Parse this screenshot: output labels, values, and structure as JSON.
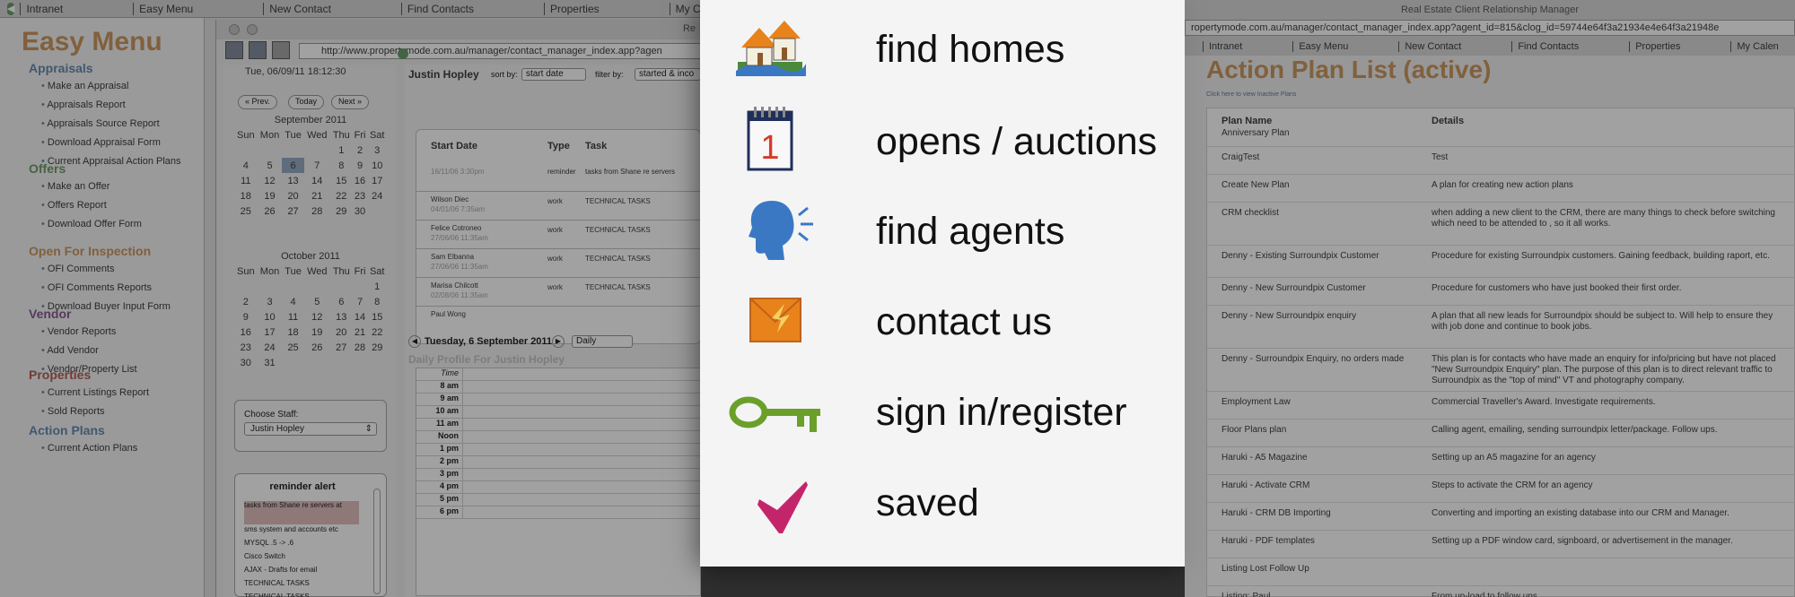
{
  "left_app": {
    "topnav": [
      "Intranet",
      "Easy Menu",
      "New Contact",
      "Find Contacts",
      "Properties",
      "My Calendar",
      "My"
    ],
    "brand": "Easy Menu",
    "sections": [
      {
        "title": "Appraisals",
        "color": "#3a7bc8",
        "items": [
          "Make an Appraisal",
          "Appraisals Report",
          "Appraisals Source Report",
          "Download Appraisal Form",
          "Current Appraisal Action Plans"
        ]
      },
      {
        "title": "Offers",
        "color": "#3a9a3a",
        "items": [
          "Make an Offer",
          "Offers Report",
          "Download Offer Form"
        ]
      },
      {
        "title": "Open For Inspection",
        "color": "#e8821a",
        "items": [
          "OFI Comments",
          "OFI Comments Reports",
          "Download Buyer Input Form"
        ]
      },
      {
        "title": "Vendor",
        "color": "#8a3aa8",
        "items": [
          "Vendor Reports",
          "Add Vendor",
          "Vendor/Property List"
        ]
      },
      {
        "title": "Properties",
        "color": "#d83a2a",
        "items": [
          "Current Listings Report",
          "Sold Reports"
        ]
      },
      {
        "title": "Action Plans",
        "color": "#3a7bc8",
        "items": [
          "Current Action Plans"
        ]
      }
    ],
    "browser": {
      "window_title": "Re",
      "url": "http://www.propertymode.com.au/manager/contact_manager_index.app?agen",
      "datetime": "Tue, 06/09/11 18:12:30",
      "nav": {
        "prev": "« Prev.",
        "today": "Today",
        "next": "Next »"
      },
      "calendars": [
        {
          "month": "September 2011",
          "headers": [
            "Sun",
            "Mon",
            "Tue",
            "Wed",
            "Thu",
            "Fri",
            "Sat"
          ],
          "weeks": [
            [
              "",
              "",
              "",
              "",
              "1",
              "2",
              "3"
            ],
            [
              "4",
              "5",
              "6",
              "7",
              "8",
              "9",
              "10"
            ],
            [
              "11",
              "12",
              "13",
              "14",
              "15",
              "16",
              "17"
            ],
            [
              "18",
              "19",
              "20",
              "21",
              "22",
              "23",
              "24"
            ],
            [
              "25",
              "26",
              "27",
              "28",
              "29",
              "30",
              ""
            ]
          ]
        },
        {
          "month": "October 2011",
          "headers": [
            "Sun",
            "Mon",
            "Tue",
            "Wed",
            "Thu",
            "Fri",
            "Sat"
          ],
          "weeks": [
            [
              "",
              "",
              "",
              "",
              "",
              "",
              "1"
            ],
            [
              "2",
              "3",
              "4",
              "5",
              "6",
              "7",
              "8"
            ],
            [
              "9",
              "10",
              "11",
              "12",
              "13",
              "14",
              "15"
            ],
            [
              "16",
              "17",
              "18",
              "19",
              "20",
              "21",
              "22"
            ],
            [
              "23",
              "24",
              "25",
              "26",
              "27",
              "28",
              "29"
            ],
            [
              "30",
              "31",
              "",
              "",
              "",
              "",
              ""
            ]
          ]
        }
      ],
      "choose_staff_label": "Choose Staff:",
      "staff_value": "Justin Hopley",
      "reminder_title": "reminder alert",
      "reminders": [
        "tasks from Shane re servers at",
        "sms system and accounts etc",
        "MYSQL .5 -> .6",
        "Cisco Switch",
        "AJAX - Drafts for email",
        "TECHNICAL TASKS",
        "TECHNICAL TASKS"
      ],
      "contact_name": "Justin Hopley",
      "sort_by_label": "sort by:",
      "sort_value": "start date",
      "filter_label": "filter by:",
      "filter_value": "started & inco",
      "table_headers": [
        "Start Date",
        "Type",
        "Task"
      ],
      "tasks": [
        {
          "name": "",
          "date": "16/11/06 3:30pm",
          "type": "reminder",
          "task": "tasks from Shane re servers"
        },
        {
          "name": "Wilson Diec",
          "date": "04/01/06 7:35am",
          "type": "work",
          "task": "TECHNICAL TASKS"
        },
        {
          "name": "Felice Cotroneo",
          "date": "27/06/06 11:35am",
          "type": "work",
          "task": "TECHNICAL TASKS"
        },
        {
          "name": "Sam Elbanna",
          "date": "27/06/06 11:35am",
          "type": "work",
          "task": "TECHNICAL TASKS"
        },
        {
          "name": "Marisa Chilcott",
          "date": "02/08/06 11:35am",
          "type": "work",
          "task": "TECHNICAL TASKS"
        },
        {
          "name": "Paul Wong",
          "date": "",
          "type": "",
          "task": ""
        }
      ],
      "day_date": "Tuesday, 6 September 2011",
      "view_value": "Daily",
      "daily_profile_title": "Daily Profile For Justin Hopley",
      "time_header": "Time",
      "times": [
        "8 am",
        "9 am",
        "10 am",
        "11 am",
        "Noon",
        "1 pm",
        "2 pm",
        "3 pm",
        "4 pm",
        "5 pm",
        "6 pm"
      ]
    }
  },
  "center_menu": [
    {
      "label": "find homes",
      "icon": "house-icon"
    },
    {
      "label": "opens / auctions",
      "icon": "calendar-icon"
    },
    {
      "label": "find agents",
      "icon": "speaking-head-icon"
    },
    {
      "label": "contact us",
      "icon": "envelope-icon"
    },
    {
      "label": "sign in/register",
      "icon": "key-icon"
    },
    {
      "label": "saved",
      "icon": "checkmark-icon"
    }
  ],
  "center_calendar_number": "1",
  "right_app": {
    "window_title": "Real Estate Client Relationship Manager",
    "url": "ropertymode.com.au/manager/contact_manager_index.app?agent_id=815&clog_id=59744e64f3a21934e4e64f3a21948e",
    "topnav": [
      "Intranet",
      "Easy Menu",
      "New Contact",
      "Find Contacts",
      "Properties",
      "My Calen"
    ],
    "title": "Action Plan List (active)",
    "subtitle": "Click here to view Inactive Plans",
    "headers": [
      "Plan Name",
      "Details"
    ],
    "plans": [
      {
        "name": "Anniversary Plan",
        "details": ""
      },
      {
        "name": "CraigTest",
        "details": "Test"
      },
      {
        "name": "Create New Plan",
        "details": "A plan for creating new action plans"
      },
      {
        "name": "CRM checklist",
        "details": "when adding a new client to the CRM, there are many things to check before switching which need to be attended to , so it all works."
      },
      {
        "name": "Denny - Existing Surroundpix Customer",
        "details": "Procedure for existing Surroundpix customers. Gaining feedback, building raport, etc."
      },
      {
        "name": "Denny - New Surroundpix Customer",
        "details": "Procedure for customers who have just booked their first order."
      },
      {
        "name": "Denny - New Surroundpix enquiry",
        "details": "A plan that all new leads for Surroundpix should be subject to. Will help to ensure they with job done and continue to book jobs."
      },
      {
        "name": "Denny - Surroundpix Enquiry, no orders made",
        "details": "This plan is for contacts who have made an enquiry for info/pricing but have not placed \"New Surroundpix Enquiry\" plan. The purpose of this plan is to direct relevant traffic to Surroundpix as the \"top of mind\" VT and photography company."
      },
      {
        "name": "Employment Law",
        "details": "Commercial Traveller's Award. Investigate requirements."
      },
      {
        "name": "Floor Plans plan",
        "details": "Calling agent, emailing, sending surroundpix letter/package. Follow ups."
      },
      {
        "name": "Haruki - A5 Magazine",
        "details": "Setting up an A5 magazine for an agency"
      },
      {
        "name": "Haruki - Activate CRM",
        "details": "Steps to activate the CRM for an agency"
      },
      {
        "name": "Haruki - CRM DB Importing",
        "details": "Converting and importing an existing database into our CRM and Manager."
      },
      {
        "name": "Haruki - PDF templates",
        "details": "Setting up a PDF window card, signboard, or advertisement in the manager."
      },
      {
        "name": "Listing Lost Follow Up",
        "details": ""
      },
      {
        "name": "Listing: Paul",
        "details": "From up-load to follow ups"
      }
    ]
  }
}
